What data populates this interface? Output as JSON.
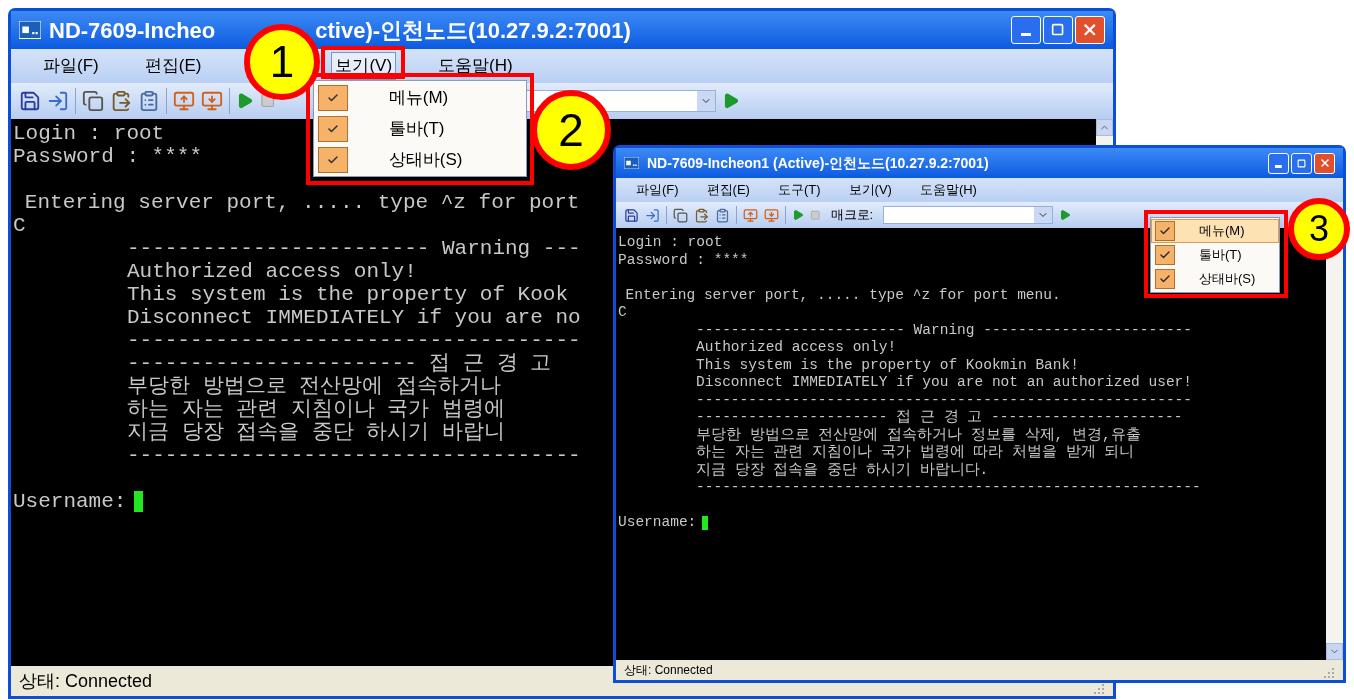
{
  "windows": [
    {
      "kind": "back",
      "title_parts": [
        "ND-7609-Incheo",
        "ctive)-인천노드(10.27.9.2:7001)"
      ],
      "menu_groups": [
        [
          {
            "label": "파일(F)",
            "selected": false
          },
          {
            "label": "편집(E)",
            "selected": false
          }
        ],
        [
          {
            "label": "보기(V)",
            "selected": true
          },
          {
            "label": "도움말(H)",
            "selected": false
          }
        ]
      ],
      "terminal": {
        "blocks": [
          [
            {
              "text": "Login : root",
              "kind": "flush"
            },
            {
              "text": "Password : ****",
              "kind": "flush"
            }
          ],
          [
            {
              "text": "Entering server port, ..... type ^z for port",
              "kind": "offset"
            },
            {
              "text": "C",
              "kind": "flush"
            },
            {
              "text": "------------------------ Warning ---",
              "kind": "indent"
            },
            {
              "text": "Authorized access only!",
              "kind": "indent"
            },
            {
              "text": "This system is the property of Kook",
              "kind": "indent"
            },
            {
              "text": "Disconnect IMMEDIATELY if you are no",
              "kind": "indent"
            },
            {
              "text": "------------------------------------",
              "kind": "indent"
            },
            {
              "text": "----------------------- 접 근 경 고",
              "kind": "indent"
            },
            {
              "text": "부당한 방법으로 전산망에 접속하거나",
              "kind": "indent"
            },
            {
              "text": "하는 자는 관련 지침이나 국가 법령에",
              "kind": "indent"
            },
            {
              "text": "지금 당장 접속을 중단 하시기 바랍니",
              "kind": "indent"
            },
            {
              "text": "------------------------------------",
              "kind": "indent"
            }
          ]
        ],
        "prompt": "Username:"
      },
      "status": "상태: Connected",
      "dropdown": [
        {
          "label": "메뉴(M)",
          "checked": true,
          "selected": false
        },
        {
          "label": "툴바(T)",
          "checked": true,
          "selected": false
        },
        {
          "label": "상태바(S)",
          "checked": true,
          "selected": false
        }
      ]
    },
    {
      "kind": "front",
      "title_parts": [
        "ND-7609-Incheon1 (Active)-인천노드(10.27.9.2:7001)"
      ],
      "menu_groups": [
        [
          {
            "label": "파일(F)",
            "selected": false
          },
          {
            "label": "편집(E)",
            "selected": false
          },
          {
            "label": "도구(T)",
            "selected": false
          },
          {
            "label": "보기(V)",
            "selected": false
          },
          {
            "label": "도움말(H)",
            "selected": false
          }
        ]
      ],
      "macro_label": "매크로:",
      "terminal": {
        "blocks": [
          [
            {
              "text": "Login : root",
              "kind": "flush"
            },
            {
              "text": "Password : ****",
              "kind": "flush"
            }
          ],
          [
            {
              "text": "Entering server port, ..... type ^z for port menu.",
              "kind": "offset"
            },
            {
              "text": "C",
              "kind": "flush"
            },
            {
              "text": "------------------------ Warning ------------------------",
              "kind": "indent"
            },
            {
              "text": "Authorized access only!",
              "kind": "indent"
            },
            {
              "text": "This system is the property of Kookmin Bank!",
              "kind": "indent"
            },
            {
              "text": "Disconnect IMMEDIATELY if you are not an authorized user!",
              "kind": "indent"
            },
            {
              "text": "---------------------------------------------------------",
              "kind": "indent"
            },
            {
              "text": "---------------------- 접 근 경 고 ----------------------",
              "kind": "indent"
            },
            {
              "text": "부당한 방법으로 전산망에 접속하거나 정보를 삭제, 변경,유출",
              "kind": "indent"
            },
            {
              "text": "하는 자는 관련 지침이나 국가 법령에 따라 처벌을 받게 되니",
              "kind": "indent"
            },
            {
              "text": "지금 당장 접속을 중단 하시기 바랍니다.",
              "kind": "indent"
            },
            {
              "text": "----------------------------------------------------------",
              "kind": "indent"
            }
          ]
        ],
        "prompt": "Username:"
      },
      "status": "상태: Connected",
      "dropdown": [
        {
          "label": "메뉴(M)",
          "checked": true,
          "selected": true
        },
        {
          "label": "툴바(T)",
          "checked": true,
          "selected": false
        },
        {
          "label": "상태바(S)",
          "checked": true,
          "selected": false
        }
      ]
    }
  ],
  "callouts": [
    {
      "number": "1"
    },
    {
      "number": "2"
    },
    {
      "number": "3"
    }
  ]
}
